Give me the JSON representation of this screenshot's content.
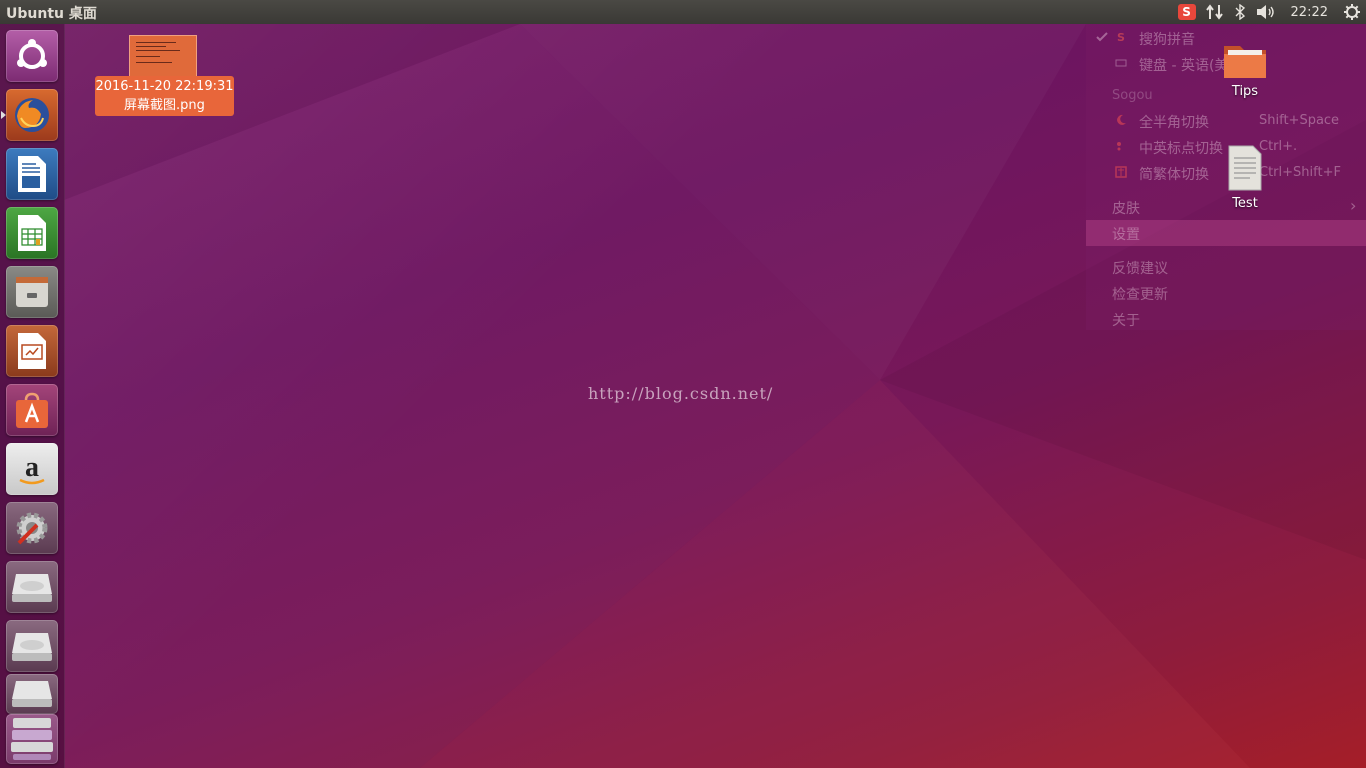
{
  "top_panel": {
    "title": "Ubuntu 桌面",
    "tray": {
      "sogou_icon": "sogou-s-icon",
      "network_icon": "network-updown-icon",
      "bluetooth_icon": "bluetooth-icon",
      "volume_icon": "volume-icon",
      "clock": "22:22",
      "settings_icon": "gear-power-icon"
    }
  },
  "launcher": {
    "items": [
      {
        "name": "dash-home",
        "icon": "ubuntu-logo-icon"
      },
      {
        "name": "firefox",
        "icon": "firefox-icon",
        "running": true
      },
      {
        "name": "libreoffice-writer",
        "icon": "writer-icon"
      },
      {
        "name": "libreoffice-calc",
        "icon": "calc-icon"
      },
      {
        "name": "files",
        "icon": "file-cabinet-icon"
      },
      {
        "name": "libreoffice-impress",
        "icon": "impress-icon"
      },
      {
        "name": "ubuntu-software",
        "icon": "software-bag-icon"
      },
      {
        "name": "amazon",
        "icon": "amazon-icon"
      },
      {
        "name": "system-settings",
        "icon": "settings-wrench-icon"
      },
      {
        "name": "drive-1",
        "icon": "hard-drive-icon"
      },
      {
        "name": "drive-2",
        "icon": "hard-drive-icon"
      },
      {
        "name": "drive-3",
        "icon": "hard-drive-icon"
      },
      {
        "name": "trash-stack",
        "icon": "stacked-drives-icon"
      }
    ]
  },
  "desktop": {
    "selected_file": {
      "line1": "2016-11-20 22:19:31",
      "line2": "屏幕截图.png"
    },
    "icons": [
      {
        "label": "Tips",
        "icon": "folder-icon"
      },
      {
        "label": "Test",
        "icon": "text-document-icon"
      }
    ],
    "watermark": "http://blog.csdn.net/"
  },
  "sogou_menu": {
    "items": [
      {
        "label": "搜狗拼音",
        "icon": "check-icon"
      },
      {
        "label": "键盘 - 英语(美国)",
        "icon": "keyboard-icon"
      },
      {
        "section": "Sogou"
      },
      {
        "label": "全半角切换",
        "accel": "Shift+Space",
        "icon": "moon-icon"
      },
      {
        "label": "中英标点切换",
        "accel": "Ctrl+.",
        "icon": "punctuation-icon"
      },
      {
        "label": "简繁体切换",
        "accel": "Ctrl+Shift+F",
        "icon": "traditional-icon"
      },
      {
        "label": "皮肤",
        "submenu": true
      },
      {
        "label": "设置",
        "highlighted": true
      },
      {
        "label": "反馈建议"
      },
      {
        "label": "检查更新"
      },
      {
        "label": "关于"
      }
    ],
    "submenu_arrow": "›"
  },
  "colors": {
    "accent_orange": "#e8663a",
    "panel_bg": "#3a3935",
    "sogou_red": "#e8473b"
  }
}
